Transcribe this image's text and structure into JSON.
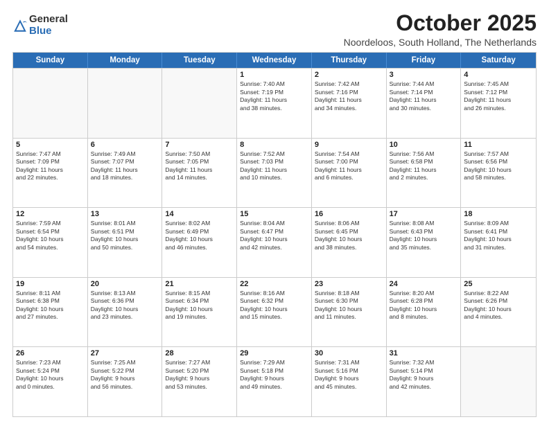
{
  "logo": {
    "general": "General",
    "blue": "Blue"
  },
  "header": {
    "month": "October 2025",
    "location": "Noordeloos, South Holland, The Netherlands"
  },
  "weekdays": [
    "Sunday",
    "Monday",
    "Tuesday",
    "Wednesday",
    "Thursday",
    "Friday",
    "Saturday"
  ],
  "weeks": [
    [
      {
        "day": "",
        "info": ""
      },
      {
        "day": "",
        "info": ""
      },
      {
        "day": "",
        "info": ""
      },
      {
        "day": "1",
        "info": "Sunrise: 7:40 AM\nSunset: 7:19 PM\nDaylight: 11 hours\nand 38 minutes."
      },
      {
        "day": "2",
        "info": "Sunrise: 7:42 AM\nSunset: 7:16 PM\nDaylight: 11 hours\nand 34 minutes."
      },
      {
        "day": "3",
        "info": "Sunrise: 7:44 AM\nSunset: 7:14 PM\nDaylight: 11 hours\nand 30 minutes."
      },
      {
        "day": "4",
        "info": "Sunrise: 7:45 AM\nSunset: 7:12 PM\nDaylight: 11 hours\nand 26 minutes."
      }
    ],
    [
      {
        "day": "5",
        "info": "Sunrise: 7:47 AM\nSunset: 7:09 PM\nDaylight: 11 hours\nand 22 minutes."
      },
      {
        "day": "6",
        "info": "Sunrise: 7:49 AM\nSunset: 7:07 PM\nDaylight: 11 hours\nand 18 minutes."
      },
      {
        "day": "7",
        "info": "Sunrise: 7:50 AM\nSunset: 7:05 PM\nDaylight: 11 hours\nand 14 minutes."
      },
      {
        "day": "8",
        "info": "Sunrise: 7:52 AM\nSunset: 7:03 PM\nDaylight: 11 hours\nand 10 minutes."
      },
      {
        "day": "9",
        "info": "Sunrise: 7:54 AM\nSunset: 7:00 PM\nDaylight: 11 hours\nand 6 minutes."
      },
      {
        "day": "10",
        "info": "Sunrise: 7:56 AM\nSunset: 6:58 PM\nDaylight: 11 hours\nand 2 minutes."
      },
      {
        "day": "11",
        "info": "Sunrise: 7:57 AM\nSunset: 6:56 PM\nDaylight: 10 hours\nand 58 minutes."
      }
    ],
    [
      {
        "day": "12",
        "info": "Sunrise: 7:59 AM\nSunset: 6:54 PM\nDaylight: 10 hours\nand 54 minutes."
      },
      {
        "day": "13",
        "info": "Sunrise: 8:01 AM\nSunset: 6:51 PM\nDaylight: 10 hours\nand 50 minutes."
      },
      {
        "day": "14",
        "info": "Sunrise: 8:02 AM\nSunset: 6:49 PM\nDaylight: 10 hours\nand 46 minutes."
      },
      {
        "day": "15",
        "info": "Sunrise: 8:04 AM\nSunset: 6:47 PM\nDaylight: 10 hours\nand 42 minutes."
      },
      {
        "day": "16",
        "info": "Sunrise: 8:06 AM\nSunset: 6:45 PM\nDaylight: 10 hours\nand 38 minutes."
      },
      {
        "day": "17",
        "info": "Sunrise: 8:08 AM\nSunset: 6:43 PM\nDaylight: 10 hours\nand 35 minutes."
      },
      {
        "day": "18",
        "info": "Sunrise: 8:09 AM\nSunset: 6:41 PM\nDaylight: 10 hours\nand 31 minutes."
      }
    ],
    [
      {
        "day": "19",
        "info": "Sunrise: 8:11 AM\nSunset: 6:38 PM\nDaylight: 10 hours\nand 27 minutes."
      },
      {
        "day": "20",
        "info": "Sunrise: 8:13 AM\nSunset: 6:36 PM\nDaylight: 10 hours\nand 23 minutes."
      },
      {
        "day": "21",
        "info": "Sunrise: 8:15 AM\nSunset: 6:34 PM\nDaylight: 10 hours\nand 19 minutes."
      },
      {
        "day": "22",
        "info": "Sunrise: 8:16 AM\nSunset: 6:32 PM\nDaylight: 10 hours\nand 15 minutes."
      },
      {
        "day": "23",
        "info": "Sunrise: 8:18 AM\nSunset: 6:30 PM\nDaylight: 10 hours\nand 11 minutes."
      },
      {
        "day": "24",
        "info": "Sunrise: 8:20 AM\nSunset: 6:28 PM\nDaylight: 10 hours\nand 8 minutes."
      },
      {
        "day": "25",
        "info": "Sunrise: 8:22 AM\nSunset: 6:26 PM\nDaylight: 10 hours\nand 4 minutes."
      }
    ],
    [
      {
        "day": "26",
        "info": "Sunrise: 7:23 AM\nSunset: 5:24 PM\nDaylight: 10 hours\nand 0 minutes."
      },
      {
        "day": "27",
        "info": "Sunrise: 7:25 AM\nSunset: 5:22 PM\nDaylight: 9 hours\nand 56 minutes."
      },
      {
        "day": "28",
        "info": "Sunrise: 7:27 AM\nSunset: 5:20 PM\nDaylight: 9 hours\nand 53 minutes."
      },
      {
        "day": "29",
        "info": "Sunrise: 7:29 AM\nSunset: 5:18 PM\nDaylight: 9 hours\nand 49 minutes."
      },
      {
        "day": "30",
        "info": "Sunrise: 7:31 AM\nSunset: 5:16 PM\nDaylight: 9 hours\nand 45 minutes."
      },
      {
        "day": "31",
        "info": "Sunrise: 7:32 AM\nSunset: 5:14 PM\nDaylight: 9 hours\nand 42 minutes."
      },
      {
        "day": "",
        "info": ""
      }
    ]
  ]
}
